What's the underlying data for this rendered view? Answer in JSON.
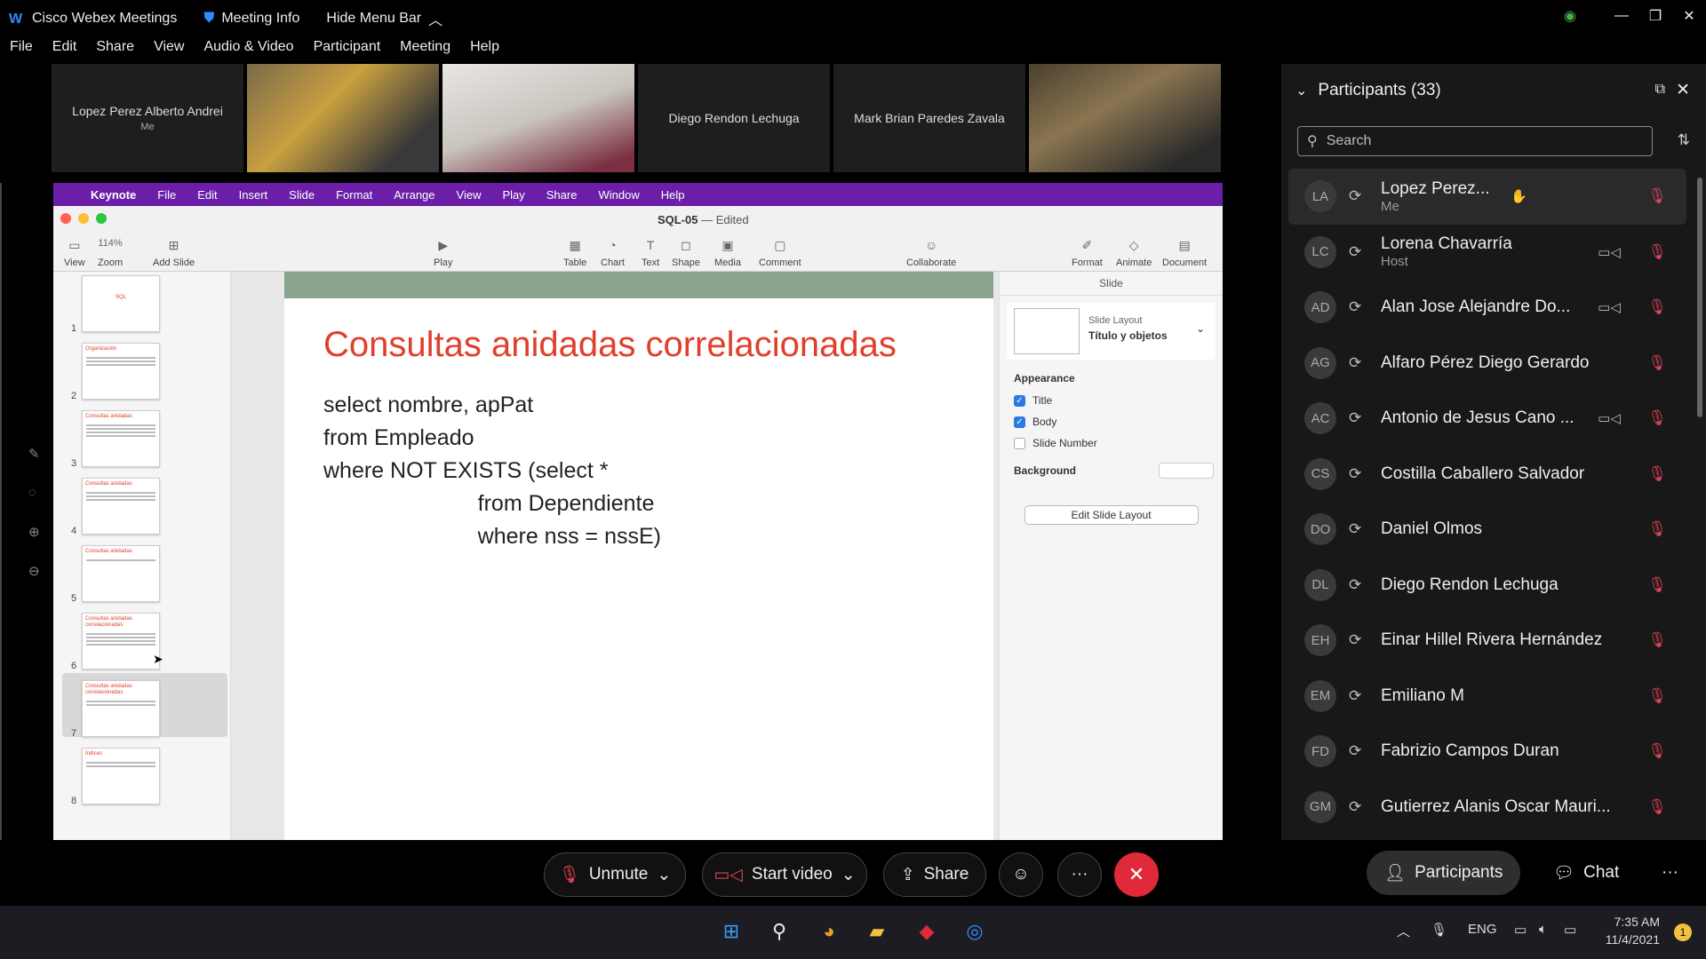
{
  "titlebar": {
    "app_name": "Cisco Webex Meetings",
    "meeting_info": "Meeting Info",
    "hide_menu": "Hide Menu Bar"
  },
  "menubar": [
    "File",
    "Edit",
    "Share",
    "View",
    "Audio & Video",
    "Participant",
    "Meeting",
    "Help"
  ],
  "tiles": [
    {
      "name": "Lopez Perez Alberto Andrei",
      "sub": "Me"
    },
    {
      "name": "",
      "sub": ""
    },
    {
      "name": "",
      "sub": ""
    },
    {
      "name": "Diego Rendon Lechuga",
      "sub": ""
    },
    {
      "name": "Mark Brian Paredes Zavala",
      "sub": ""
    },
    {
      "name": "",
      "sub": ""
    }
  ],
  "keynote": {
    "menu": [
      "Keynote",
      "File",
      "Edit",
      "Insert",
      "Slide",
      "Format",
      "Arrange",
      "View",
      "Play",
      "Share",
      "Window",
      "Help"
    ],
    "doc_name": "SQL-05",
    "doc_status": "— Edited",
    "zoom": "114%",
    "toolbar": {
      "view": "View",
      "zoom": "Zoom",
      "add_slide": "Add Slide",
      "play": "Play",
      "table": "Table",
      "chart": "Chart",
      "text": "Text",
      "shape": "Shape",
      "media": "Media",
      "comment": "Comment",
      "collaborate": "Collaborate",
      "format": "Format",
      "animate": "Animate",
      "document": "Document"
    },
    "slide_numbers": [
      "1",
      "2",
      "3",
      "4",
      "5",
      "6",
      "7",
      "8"
    ],
    "thumb_titles": [
      "SQL",
      "Organización",
      "Consultas anidadas",
      "Consultas anidadas",
      "Consultas anidadas",
      "Consultas anidadas correlacionadas",
      "Consultas anidadas correlacionadas",
      "Índices"
    ],
    "slide": {
      "title": "Consultas anidadas correlacionadas",
      "code": "select nombre, apPat\nfrom Empleado\nwhere NOT EXISTS (select *\n                         from Dependiente\n                         where nss = nssE)"
    },
    "inspector": {
      "header": "Slide",
      "layout_label": "Slide Layout",
      "layout_value": "Título y objetos",
      "appearance": "Appearance",
      "title_cb": "Title",
      "body_cb": "Body",
      "slide_number_cb": "Slide Number",
      "background": "Background",
      "edit_layout": "Edit Slide Layout"
    }
  },
  "participants": {
    "header": "Participants (33)",
    "search_placeholder": "Search",
    "list": [
      {
        "initials": "LA",
        "name": "Lopez Perez...",
        "role": "Me",
        "video": false
      },
      {
        "initials": "LC",
        "name": "Lorena Chavarría",
        "role": "Host",
        "video": true
      },
      {
        "initials": "AD",
        "name": "Alan Jose Alejandre Do...",
        "role": "",
        "video": true
      },
      {
        "initials": "AG",
        "name": "Alfaro Pérez Diego Gerardo",
        "role": "",
        "video": false
      },
      {
        "initials": "AC",
        "name": "Antonio de Jesus Cano ...",
        "role": "",
        "video": true
      },
      {
        "initials": "CS",
        "name": "Costilla Caballero Salvador",
        "role": "",
        "video": false
      },
      {
        "initials": "DO",
        "name": "Daniel Olmos",
        "role": "",
        "video": false
      },
      {
        "initials": "DL",
        "name": "Diego Rendon Lechuga",
        "role": "",
        "video": false
      },
      {
        "initials": "EH",
        "name": "Einar Hillel Rivera Hernández",
        "role": "",
        "video": false
      },
      {
        "initials": "EM",
        "name": "Emiliano M",
        "role": "",
        "video": false
      },
      {
        "initials": "FD",
        "name": "Fabrizio Campos Duran",
        "role": "",
        "video": false
      },
      {
        "initials": "GM",
        "name": "Gutierrez Alanis Oscar Mauri...",
        "role": "",
        "video": false
      }
    ]
  },
  "controls": {
    "unmute": "Unmute",
    "start_video": "Start video",
    "share": "Share",
    "participants": "Participants",
    "chat": "Chat"
  },
  "taskbar": {
    "lang": "ENG",
    "time": "7:35 AM",
    "date": "11/4/2021",
    "notifications": "1"
  }
}
